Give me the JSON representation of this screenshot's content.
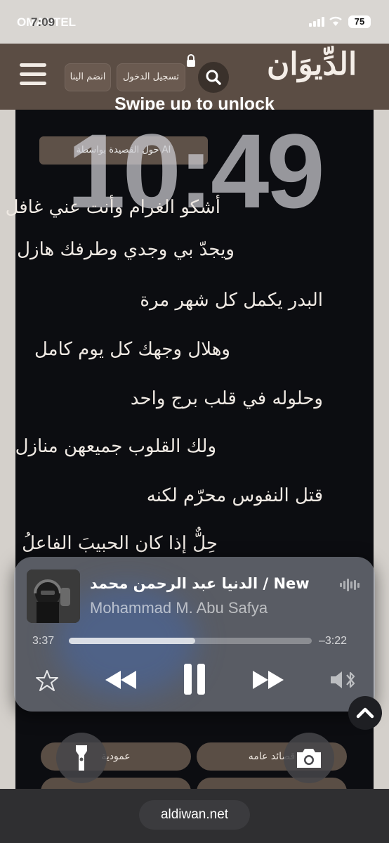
{
  "status_bar": {
    "carrier": "OMANTEL",
    "time": "7:09",
    "battery": "75"
  },
  "header": {
    "login_label": "تسجيل الدخول",
    "join_label": "انضم الينا",
    "logo_text": "الدِّيوَان"
  },
  "lock_screen": {
    "swipe_text": "Swipe up to unlock",
    "clock": "10:49"
  },
  "share_tag": "حول القصيدة بواسطة AI",
  "poem": {
    "lines": [
      "أشكو الغرام وأنت عني غافل",
      "ويجدّ بي وجدي وطرفك هازل",
      "البدر يكمل كل شهر مرة",
      "وهلال وجهك كل يوم كامل",
      "وحلوله في قلب برج واحد",
      "ولك القلوب جميعهن منازل",
      "قتل النفوس محرّم لكنه",
      "حِلٌّ إذا كان الحبيبَ الفاعلُ"
    ]
  },
  "player": {
    "title": "الدنيا عبد الرحمن محمد / New",
    "artist": "Mohammad M. Abu Safya",
    "elapsed": "3:37",
    "remaining": "–3:22",
    "progress": 0.52
  },
  "categories": [
    "عمودية",
    "قصائد عامه"
  ],
  "browser": {
    "url": "aldiwan.net"
  }
}
